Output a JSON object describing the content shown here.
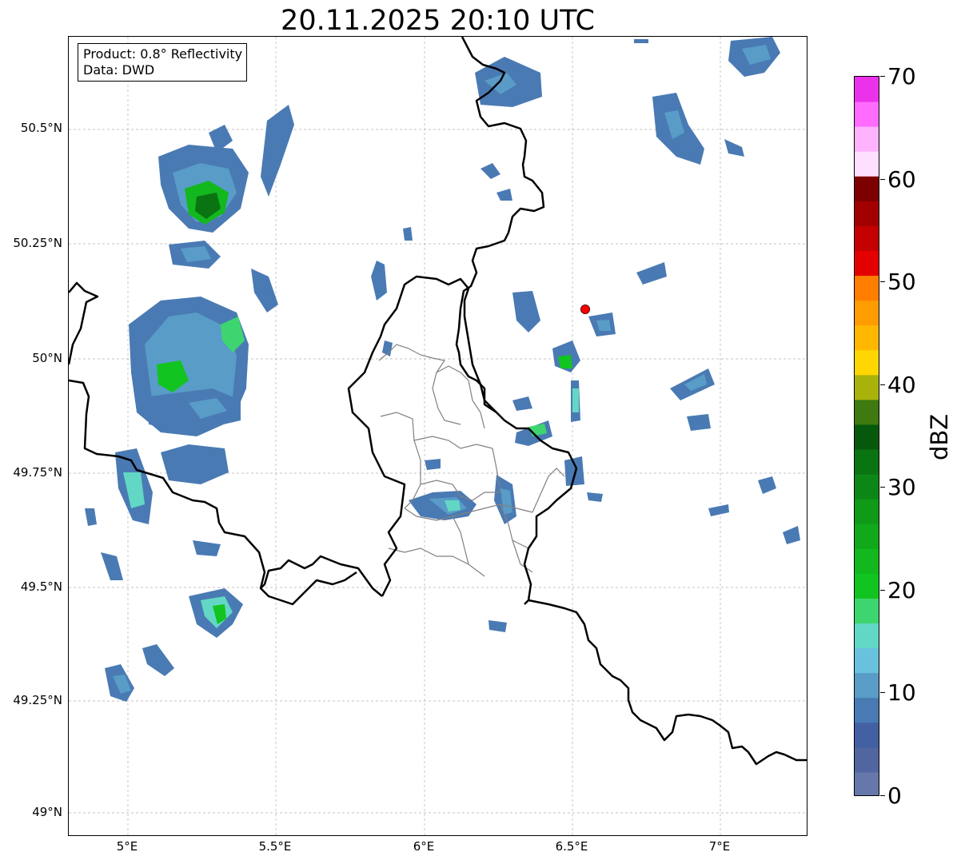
{
  "title": "20.11.2025 20:10 UTC",
  "info": {
    "line1": "Product: 0.8° Reflectivity",
    "line2": "Data: DWD"
  },
  "axes": {
    "lat_labels": [
      "50.5°N",
      "50.25°N",
      "50°N",
      "49.75°N",
      "49.5°N",
      "49.25°N",
      "49°N"
    ],
    "lon_labels": [
      "5°E",
      "5.5°E",
      "6°E",
      "6.5°E",
      "7°E"
    ]
  },
  "colorbar": {
    "label": "dBZ",
    "tick_labels": [
      "0",
      "10",
      "20",
      "30",
      "40",
      "50",
      "60",
      "70"
    ],
    "colors": [
      "#6677aa",
      "#5165a0",
      "#4360a3",
      "#4a7ab3",
      "#589cc7",
      "#68c2de",
      "#63d7c5",
      "#3dd56f",
      "#12c41f",
      "#12b81d",
      "#11a81a",
      "#0f9a17",
      "#0c8715",
      "#0a7312",
      "#06590c",
      "#3f7a10",
      "#a9b20b",
      "#ffd700",
      "#ffb700",
      "#ff9c00",
      "#ff7e00",
      "#e50000",
      "#c40000",
      "#a20000",
      "#7c0000",
      "#ffdfff",
      "#ffb3ff",
      "#ff6cff",
      "#eb32eb"
    ]
  },
  "marker": {
    "color": "#ff0000",
    "lon": 6.55,
    "lat": 50.11
  },
  "map": {
    "extent": {
      "lon_min": 4.8,
      "lon_max": 7.3,
      "lat_min": 48.96,
      "lat_max": 50.68
    },
    "gridlines": true
  }
}
